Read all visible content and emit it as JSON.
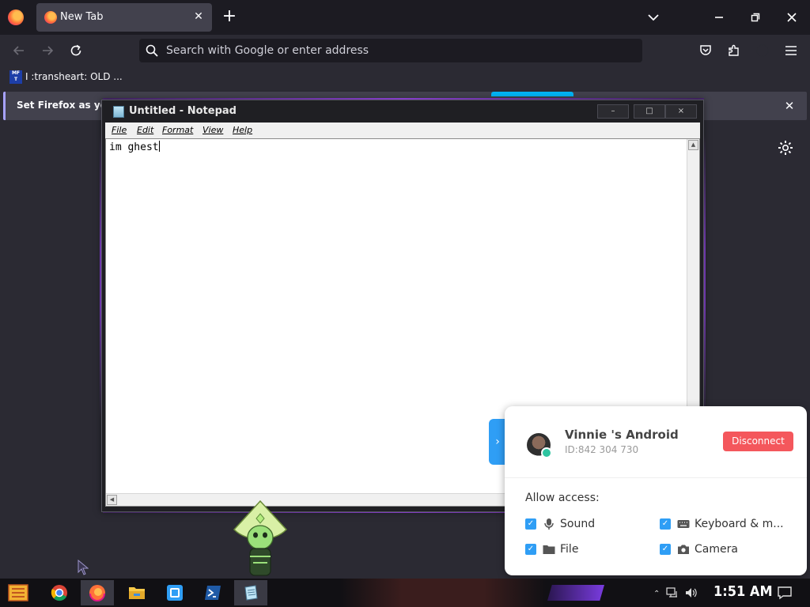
{
  "browser": {
    "tab": {
      "title": "New Tab"
    },
    "urlbar": {
      "placeholder": "Search with Google or enter address"
    },
    "bookmarks": [
      {
        "icon_text": "MF T",
        "label": "I :transheart: OLD ..."
      }
    ],
    "notification": {
      "text": "Set Firefox as yo"
    }
  },
  "notepad": {
    "title": "Untitled - Notepad",
    "menu": [
      "File",
      "Edit",
      "Format",
      "View",
      "Help"
    ],
    "content": "im ghest",
    "controls": {
      "minimize": "–",
      "maximize": "□",
      "close": "×"
    }
  },
  "remote_panel": {
    "device_name": "Vinnie 's Android",
    "device_id": "ID:842 304 730",
    "disconnect_label": "Disconnect",
    "allow_label": "Allow access:",
    "expand_arrow": "›",
    "options": [
      {
        "label": "Sound",
        "checked": true,
        "icon": "microphone-icon"
      },
      {
        "label": "Keyboard & m...",
        "checked": true,
        "icon": "keyboard-icon"
      },
      {
        "label": "File",
        "checked": true,
        "icon": "folder-icon"
      },
      {
        "label": "Camera",
        "checked": true,
        "icon": "camera-icon"
      }
    ]
  },
  "taskbar": {
    "time": "1:51 AM",
    "apps": [
      "start-logo-icon",
      "chrome-icon",
      "firefox-icon",
      "file-explorer-icon",
      "remote-app-icon",
      "powershell-icon",
      "notepad-icon"
    ]
  },
  "colors": {
    "browser_bg": "#2b2a33",
    "tabbar_bg": "#1c1b22",
    "accent_blue": "#2f9ef5",
    "disconnect_red": "#f4575c",
    "glow_purple": "#a74cff"
  }
}
